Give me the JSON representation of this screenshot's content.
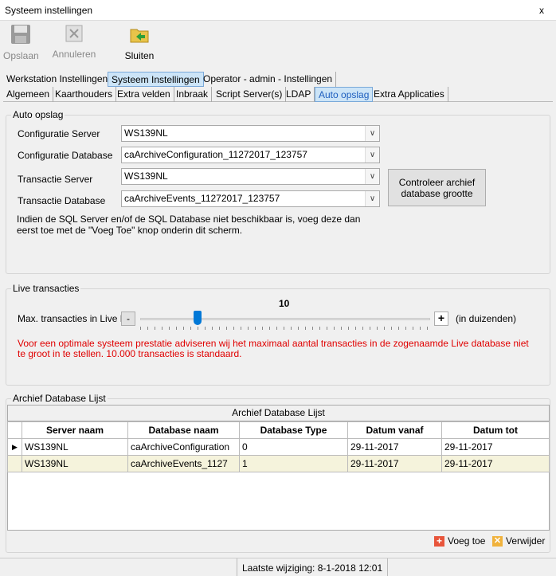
{
  "window": {
    "title": "Systeem instellingen",
    "close": "x"
  },
  "toolbar": {
    "save": "Opslaan",
    "cancel": "Annuleren",
    "close": "Sluiten"
  },
  "main_tabs": [
    "Werkstation Instellingen",
    "Systeem Instellingen",
    "Operator - admin - Instellingen"
  ],
  "sub_tabs": [
    "Algemeen",
    "Kaarthouders",
    "Extra velden",
    "Inbraak",
    "Script Server(s)",
    "LDAP",
    "Auto opslag",
    "Extra Applicaties"
  ],
  "auto_opslag": {
    "title": "Auto opslag",
    "config_server_label": "Configuratie Server",
    "config_server": "WS139NL",
    "config_db_label": "Configuratie Database",
    "config_db": "caArchiveConfiguration_11272017_123757",
    "trans_server_label": "Transactie Server",
    "trans_server": "WS139NL",
    "trans_db_label": "Transactie Database",
    "trans_db": "caArchiveEvents_11272017_123757",
    "check_button": "Controleer archief database grootte",
    "info": "Indien de SQL Server en/of de SQL Database niet beschikbaar is, voeg deze dan eerst toe met de \"Voeg Toe\" knop onderin dit scherm."
  },
  "live": {
    "title": "Live transacties",
    "label": "Max. transacties in Live DB:",
    "value": "10",
    "slider_fraction": 0.19,
    "minus": "-",
    "plus": "+",
    "unit": "(in duizenden)",
    "warning": "Voor een optimale systeem prestatie adviseren wij het maximaal aantal transacties in de zogenaamde Live database niet te groot in te stellen. 10.000 transacties is standaard."
  },
  "archive": {
    "title": "Archief Database Lijst",
    "grid_title": "Archief Database Lijst",
    "columns": [
      "Server naam",
      "Database naam",
      "Database Type",
      "Datum vanaf",
      "Datum tot"
    ],
    "rows": [
      [
        "WS139NL",
        "caArchiveConfiguration",
        "0",
        "29-11-2017",
        "29-11-2017"
      ],
      [
        "WS139NL",
        "caArchiveEvents_1127",
        "1",
        "29-11-2017",
        "29-11-2017"
      ]
    ],
    "add": "Voeg toe",
    "remove": "Verwijder"
  },
  "status": {
    "last_change": "Laatste wijziging: 8-1-2018 12:01"
  },
  "colors": {
    "warning": "#e00000",
    "selected_tab": "#cce4f7",
    "row_alt": "#f5f3dc"
  }
}
